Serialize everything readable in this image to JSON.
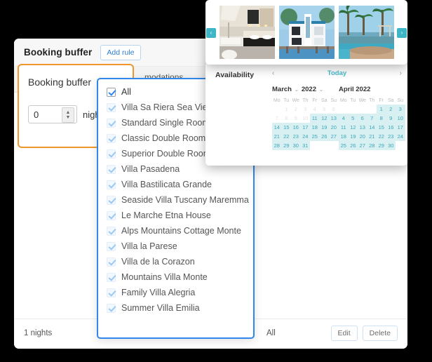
{
  "card": {
    "title": "Booking buffer",
    "add_rule_label": "Add rule",
    "tab_accommodations": "modations"
  },
  "buffer_panel": {
    "title": "Booking buffer",
    "value": "0",
    "unit": "nights",
    "stepper_up": "▲",
    "stepper_down": "▼"
  },
  "dropdown": {
    "items": [
      {
        "label": "All",
        "checked": true,
        "emphasis": "strong"
      },
      {
        "label": "Villa Sa Riera Sea View",
        "checked": true,
        "emphasis": "light"
      },
      {
        "label": "Standard Single Room",
        "checked": true,
        "emphasis": "light"
      },
      {
        "label": "Classic Double Room",
        "checked": true,
        "emphasis": "light"
      },
      {
        "label": "Superior Double Room",
        "checked": true,
        "emphasis": "light"
      },
      {
        "label": "Villa Pasadena",
        "checked": true,
        "emphasis": "light"
      },
      {
        "label": "Villa Bastilicata Grande",
        "checked": true,
        "emphasis": "light"
      },
      {
        "label": "Seaside Villa Tuscany Maremma",
        "checked": true,
        "emphasis": "light"
      },
      {
        "label": "Le Marche Etna House",
        "checked": true,
        "emphasis": "light"
      },
      {
        "label": "Alps Mountains Cottage Monte",
        "checked": true,
        "emphasis": "light"
      },
      {
        "label": "Villa la Parese",
        "checked": true,
        "emphasis": "light"
      },
      {
        "label": "Villa de la Corazon",
        "checked": true,
        "emphasis": "light"
      },
      {
        "label": "Mountains Villa Monte",
        "checked": true,
        "emphasis": "light"
      },
      {
        "label": "Family Villa Alegria",
        "checked": true,
        "emphasis": "light"
      },
      {
        "label": "Summer Villa Emilia",
        "checked": true,
        "emphasis": "light"
      }
    ]
  },
  "summary_row": {
    "nights": "1 nights",
    "accommodations": "All",
    "rates": "All",
    "edit_label": "Edit",
    "delete_label": "Delete"
  },
  "availability": {
    "label": "Availability",
    "today_label": "Today",
    "prev_icon": "‹",
    "next_icon": "›",
    "weekdays": [
      "Mo",
      "Tu",
      "We",
      "Th",
      "Fr",
      "Sa",
      "Su"
    ],
    "caret": "⌄",
    "months": [
      {
        "name": "March",
        "year": "2022",
        "has_dropdowns": true,
        "lead_blanks": 1,
        "days": 31,
        "disabled_through": 10
      },
      {
        "name": "April 2022",
        "year": "",
        "has_dropdowns": false,
        "lead_blanks": 4,
        "days": 30,
        "disabled_through": 0
      }
    ]
  },
  "gallery": {
    "prev_icon": "‹",
    "next_icon": "›",
    "images": [
      {
        "name": "bathroom-interior-photo"
      },
      {
        "name": "waterfront-villa-photo"
      },
      {
        "name": "tropical-pool-photo"
      }
    ]
  },
  "colors": {
    "accent_blue": "#2f86ec",
    "accent_orange": "#f0962b",
    "accent_teal": "#3fb6c6",
    "calendar_cell": "#d9f0f3"
  }
}
